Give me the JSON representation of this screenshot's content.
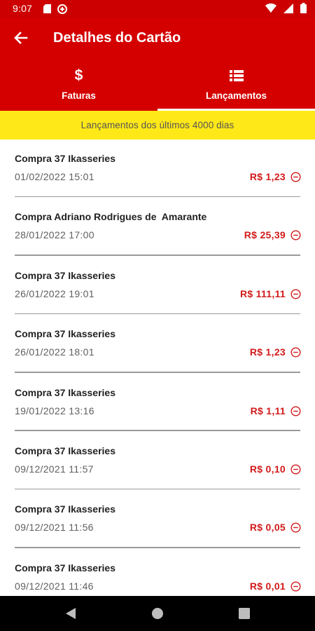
{
  "status_bar": {
    "time": "9:07",
    "icons": [
      "sd-card-icon",
      "vpn-icon",
      "wifi-icon",
      "signal-icon",
      "battery-icon"
    ]
  },
  "header": {
    "title": "Detalhes do Cartão",
    "back_icon": "arrow-left-icon",
    "tabs": [
      {
        "label": "Faturas",
        "icon": "dollar-icon",
        "active": false
      },
      {
        "label": "Lançamentos",
        "icon": "list-icon",
        "active": true
      }
    ]
  },
  "banner": {
    "text": "Lançamentos dos últimos 4000 dias"
  },
  "transactions": [
    {
      "description": "Compra 37 Ikasseries",
      "datetime": "01/02/2022 15:01",
      "amount": "R$ 1,23"
    },
    {
      "description": "Compra Adriano Rodrigues de  Amarante",
      "datetime": "28/01/2022 17:00",
      "amount": "R$ 25,39"
    },
    {
      "description": "Compra 37 Ikasseries",
      "datetime": "26/01/2022 19:01",
      "amount": "R$ 111,11"
    },
    {
      "description": "Compra 37 Ikasseries",
      "datetime": "26/01/2022 18:01",
      "amount": "R$ 1,23"
    },
    {
      "description": "Compra 37 Ikasseries",
      "datetime": "19/01/2022 13:16",
      "amount": "R$ 1,11"
    },
    {
      "description": "Compra 37 Ikasseries",
      "datetime": "09/12/2021 11:57",
      "amount": "R$ 0,10"
    },
    {
      "description": "Compra 37 Ikasseries",
      "datetime": "09/12/2021 11:56",
      "amount": "R$ 0,05"
    },
    {
      "description": "Compra 37 Ikasseries",
      "datetime": "09/12/2021 11:46",
      "amount": "R$ 0,01"
    }
  ],
  "colors": {
    "primary_red": "#d40000",
    "banner_yellow": "#ffe818",
    "amount_red": "#d11a1a"
  },
  "nav_bar": {
    "icons": [
      "back-triangle-icon",
      "home-circle-icon",
      "recents-square-icon"
    ]
  }
}
